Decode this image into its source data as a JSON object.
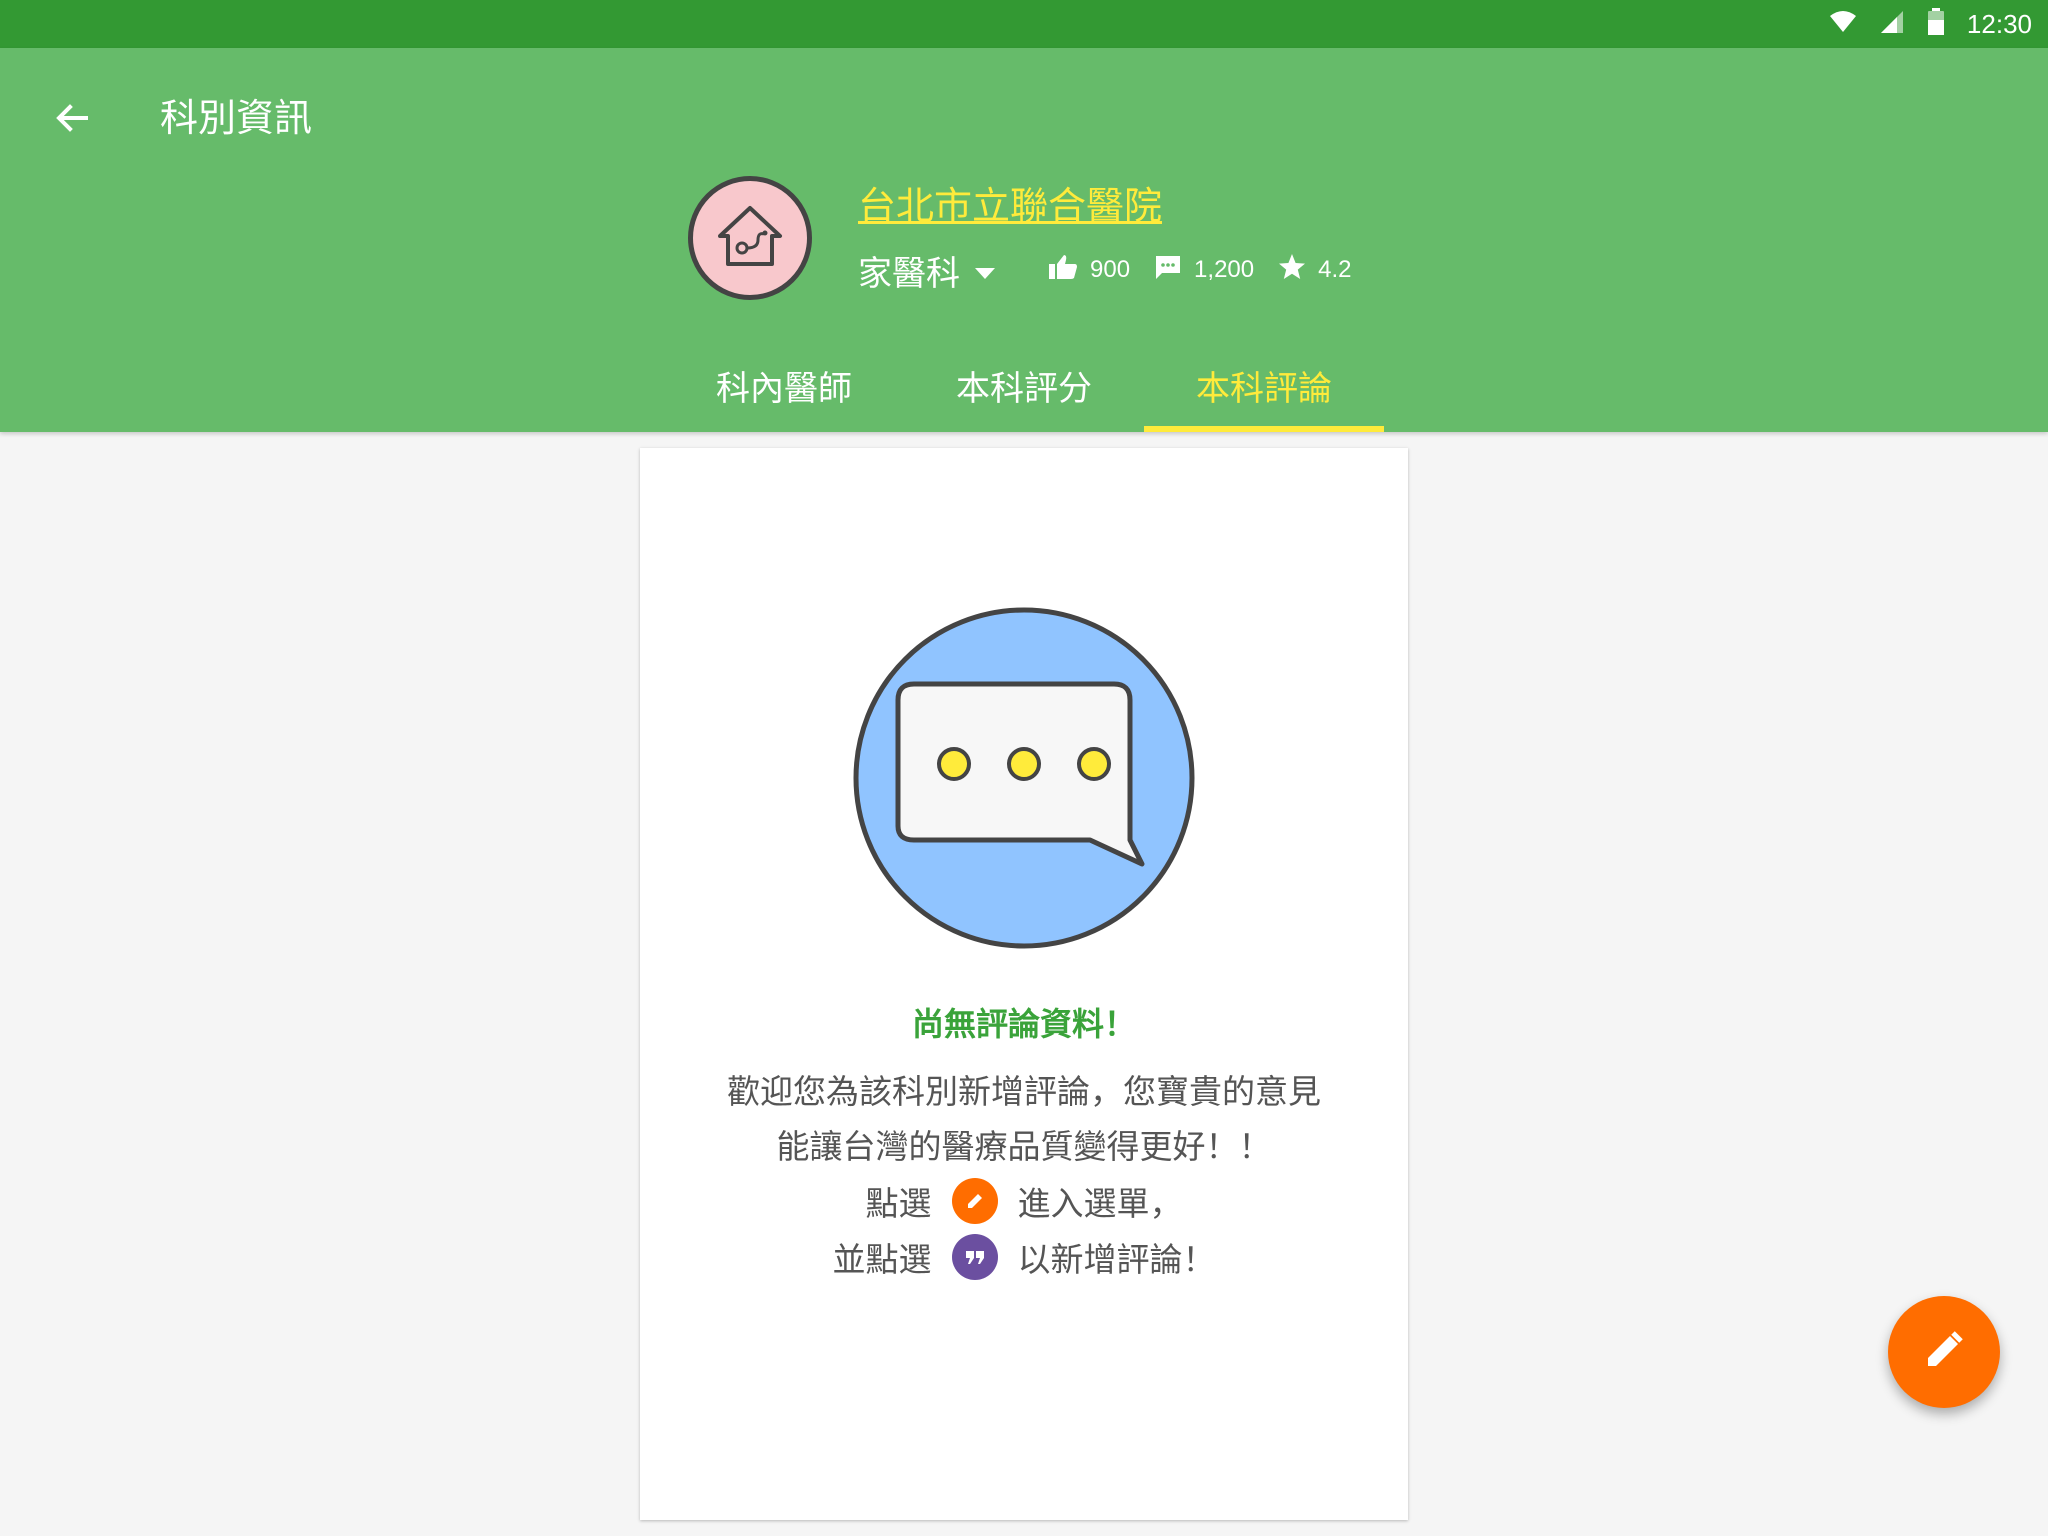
{
  "status_bar": {
    "time": "12:30",
    "icons": [
      "wifi-icon",
      "cell-signal-icon",
      "battery-icon"
    ]
  },
  "app_bar": {
    "title": "科別資訊",
    "back_icon": "arrow-left-icon"
  },
  "header": {
    "hospital_name": "台北市立聯合醫院",
    "department": "家醫科",
    "stats": {
      "likes": "900",
      "comments": "1,200",
      "rating": "4.2"
    }
  },
  "tabs": [
    {
      "label": "科內醫師",
      "active": false
    },
    {
      "label": "本科評分",
      "active": false
    },
    {
      "label": "本科評論",
      "active": true
    }
  ],
  "empty_state": {
    "title": "尚無評論資料！",
    "line1": "歡迎您為該科別新增評論，您寶貴的意見",
    "line2": "能讓台灣的醫療品質變得更好！！",
    "instr1_prefix": "點選",
    "instr1_suffix": "進入選單，",
    "instr2_prefix": "並點選",
    "instr2_suffix": "以新增評論！"
  },
  "fab": {
    "icon": "pencil-icon"
  },
  "colors": {
    "status_bar": "#339933",
    "app_bar": "#66bb6a",
    "accent": "#ffeb3b",
    "fab": "#ff6d00",
    "title_green": "#3aa33a",
    "purple": "#6b4fa0",
    "illustration_blue": "#90c4ff"
  }
}
